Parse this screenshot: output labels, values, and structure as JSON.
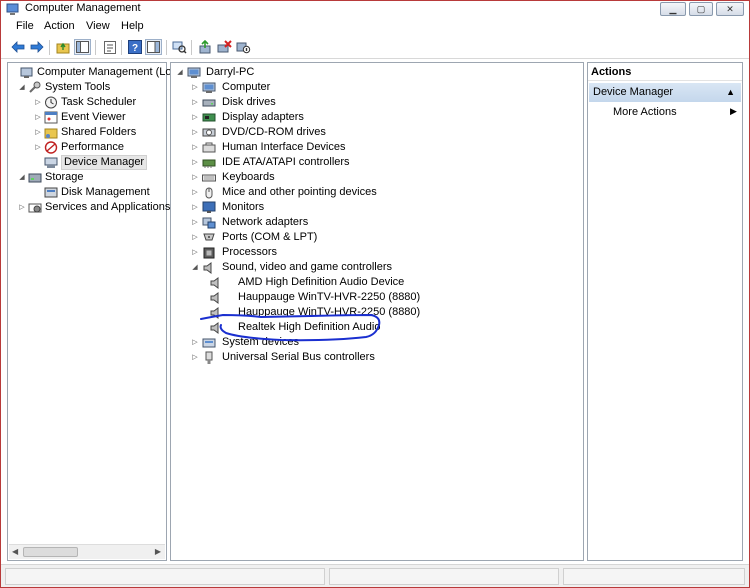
{
  "window": {
    "title": "Computer Management"
  },
  "menu": [
    "File",
    "Action",
    "View",
    "Help"
  ],
  "left_tree": [
    {
      "label": "Computer Management (Local",
      "level": 0,
      "expander": "",
      "icon": "computer-management-icon"
    },
    {
      "label": "System Tools",
      "level": 1,
      "expander": "open",
      "icon": "system-tools-icon"
    },
    {
      "label": "Task Scheduler",
      "level": 2,
      "expander": "closed",
      "icon": "clock-icon"
    },
    {
      "label": "Event Viewer",
      "level": 2,
      "expander": "closed",
      "icon": "event-viewer-icon"
    },
    {
      "label": "Shared Folders",
      "level": 2,
      "expander": "closed",
      "icon": "shared-folder-icon"
    },
    {
      "label": "Performance",
      "level": 2,
      "expander": "closed",
      "icon": "performance-icon"
    },
    {
      "label": "Device Manager",
      "level": 2,
      "expander": "",
      "icon": "device-manager-icon",
      "selected": true
    },
    {
      "label": "Storage",
      "level": 1,
      "expander": "open",
      "icon": "storage-icon"
    },
    {
      "label": "Disk Management",
      "level": 2,
      "expander": "",
      "icon": "disk-management-icon"
    },
    {
      "label": "Services and Applications",
      "level": 1,
      "expander": "closed",
      "icon": "services-icon"
    }
  ],
  "device_tree": {
    "root": "Darryl-PC",
    "categories": [
      {
        "label": "Computer",
        "icon": "computer-icon"
      },
      {
        "label": "Disk drives",
        "icon": "disk-drive-icon"
      },
      {
        "label": "Display adapters",
        "icon": "display-adapter-icon"
      },
      {
        "label": "DVD/CD-ROM drives",
        "icon": "dvd-drive-icon"
      },
      {
        "label": "Human Interface Devices",
        "icon": "hid-icon"
      },
      {
        "label": "IDE ATA/ATAPI controllers",
        "icon": "ide-controller-icon"
      },
      {
        "label": "Keyboards",
        "icon": "keyboard-icon"
      },
      {
        "label": "Mice and other pointing devices",
        "icon": "mouse-icon"
      },
      {
        "label": "Monitors",
        "icon": "monitor-icon"
      },
      {
        "label": "Network adapters",
        "icon": "network-adapter-icon"
      },
      {
        "label": "Ports (COM & LPT)",
        "icon": "port-icon"
      },
      {
        "label": "Processors",
        "icon": "processor-icon"
      },
      {
        "label": "Sound, video and game controllers",
        "icon": "speaker-icon",
        "expanded": true,
        "children": [
          "AMD High Definition Audio Device",
          "Hauppauge WinTV-HVR-2250 (8880)",
          "Hauppauge WinTV-HVR-2250 (8880)",
          "Realtek High Definition Audio"
        ]
      },
      {
        "label": "System devices",
        "icon": "system-device-icon"
      },
      {
        "label": "Universal Serial Bus controllers",
        "icon": "usb-icon"
      }
    ]
  },
  "actions": {
    "header": "Actions",
    "section": "Device Manager",
    "more": "More Actions"
  },
  "colors": {
    "annotation": "#1a2fd0",
    "title_border": "#b83a3a",
    "action_section": "#c9daee"
  }
}
